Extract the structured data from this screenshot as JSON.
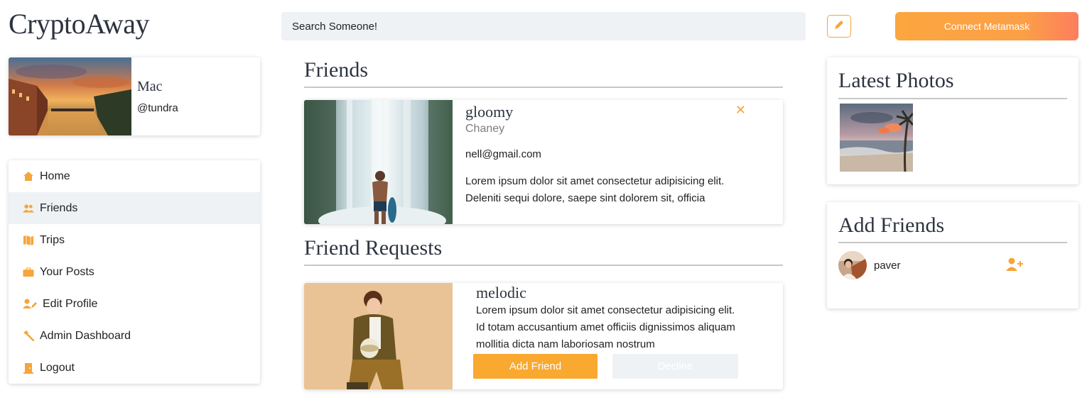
{
  "app": {
    "title": "CryptoAway"
  },
  "header": {
    "search_placeholder": "Search Someone!",
    "connect_label": "Connect Metamask",
    "edit_icon": "pencil-icon"
  },
  "profile": {
    "name": "Mac",
    "handle": "@tundra"
  },
  "nav": [
    {
      "label": "Home",
      "icon": "home-icon",
      "active": false
    },
    {
      "label": "Friends",
      "icon": "friends-icon",
      "active": true
    },
    {
      "label": "Trips",
      "icon": "map-icon",
      "active": false
    },
    {
      "label": "Your Posts",
      "icon": "briefcase-icon",
      "active": false
    },
    {
      "label": "Edit Profile",
      "icon": "user-edit-icon",
      "active": false
    },
    {
      "label": "Admin Dashboard",
      "icon": "hammer-icon",
      "active": false
    },
    {
      "label": "Logout",
      "icon": "door-icon",
      "active": false
    }
  ],
  "friends_section": {
    "title": "Friends",
    "friends": [
      {
        "username": "gloomy",
        "name": "Chaney",
        "email": "nell@gmail.com",
        "bio": "Lorem ipsum dolor sit amet consectetur adipisicing elit. Deleniti sequi dolore, saepe sint dolorem sit, officia"
      }
    ]
  },
  "requests_section": {
    "title": "Friend Requests",
    "requests": [
      {
        "username": "melodic",
        "bio": "Lorem ipsum dolor sit amet consectetur adipisicing elit. Id totam accusantium amet officiis dignissimos aliquam mollitia dicta nam laboriosam nostrum",
        "accept_label": "Add Friend",
        "decline_label": "Decline"
      }
    ]
  },
  "latest_photos": {
    "title": "Latest Photos"
  },
  "add_friends": {
    "title": "Add Friends",
    "suggestions": [
      {
        "username": "paver"
      }
    ]
  },
  "colors": {
    "accent": "#f9a830",
    "accent_gradient_end": "#fd7e5e",
    "active_bg": "#eef2f5",
    "heading": "#2d3340"
  }
}
